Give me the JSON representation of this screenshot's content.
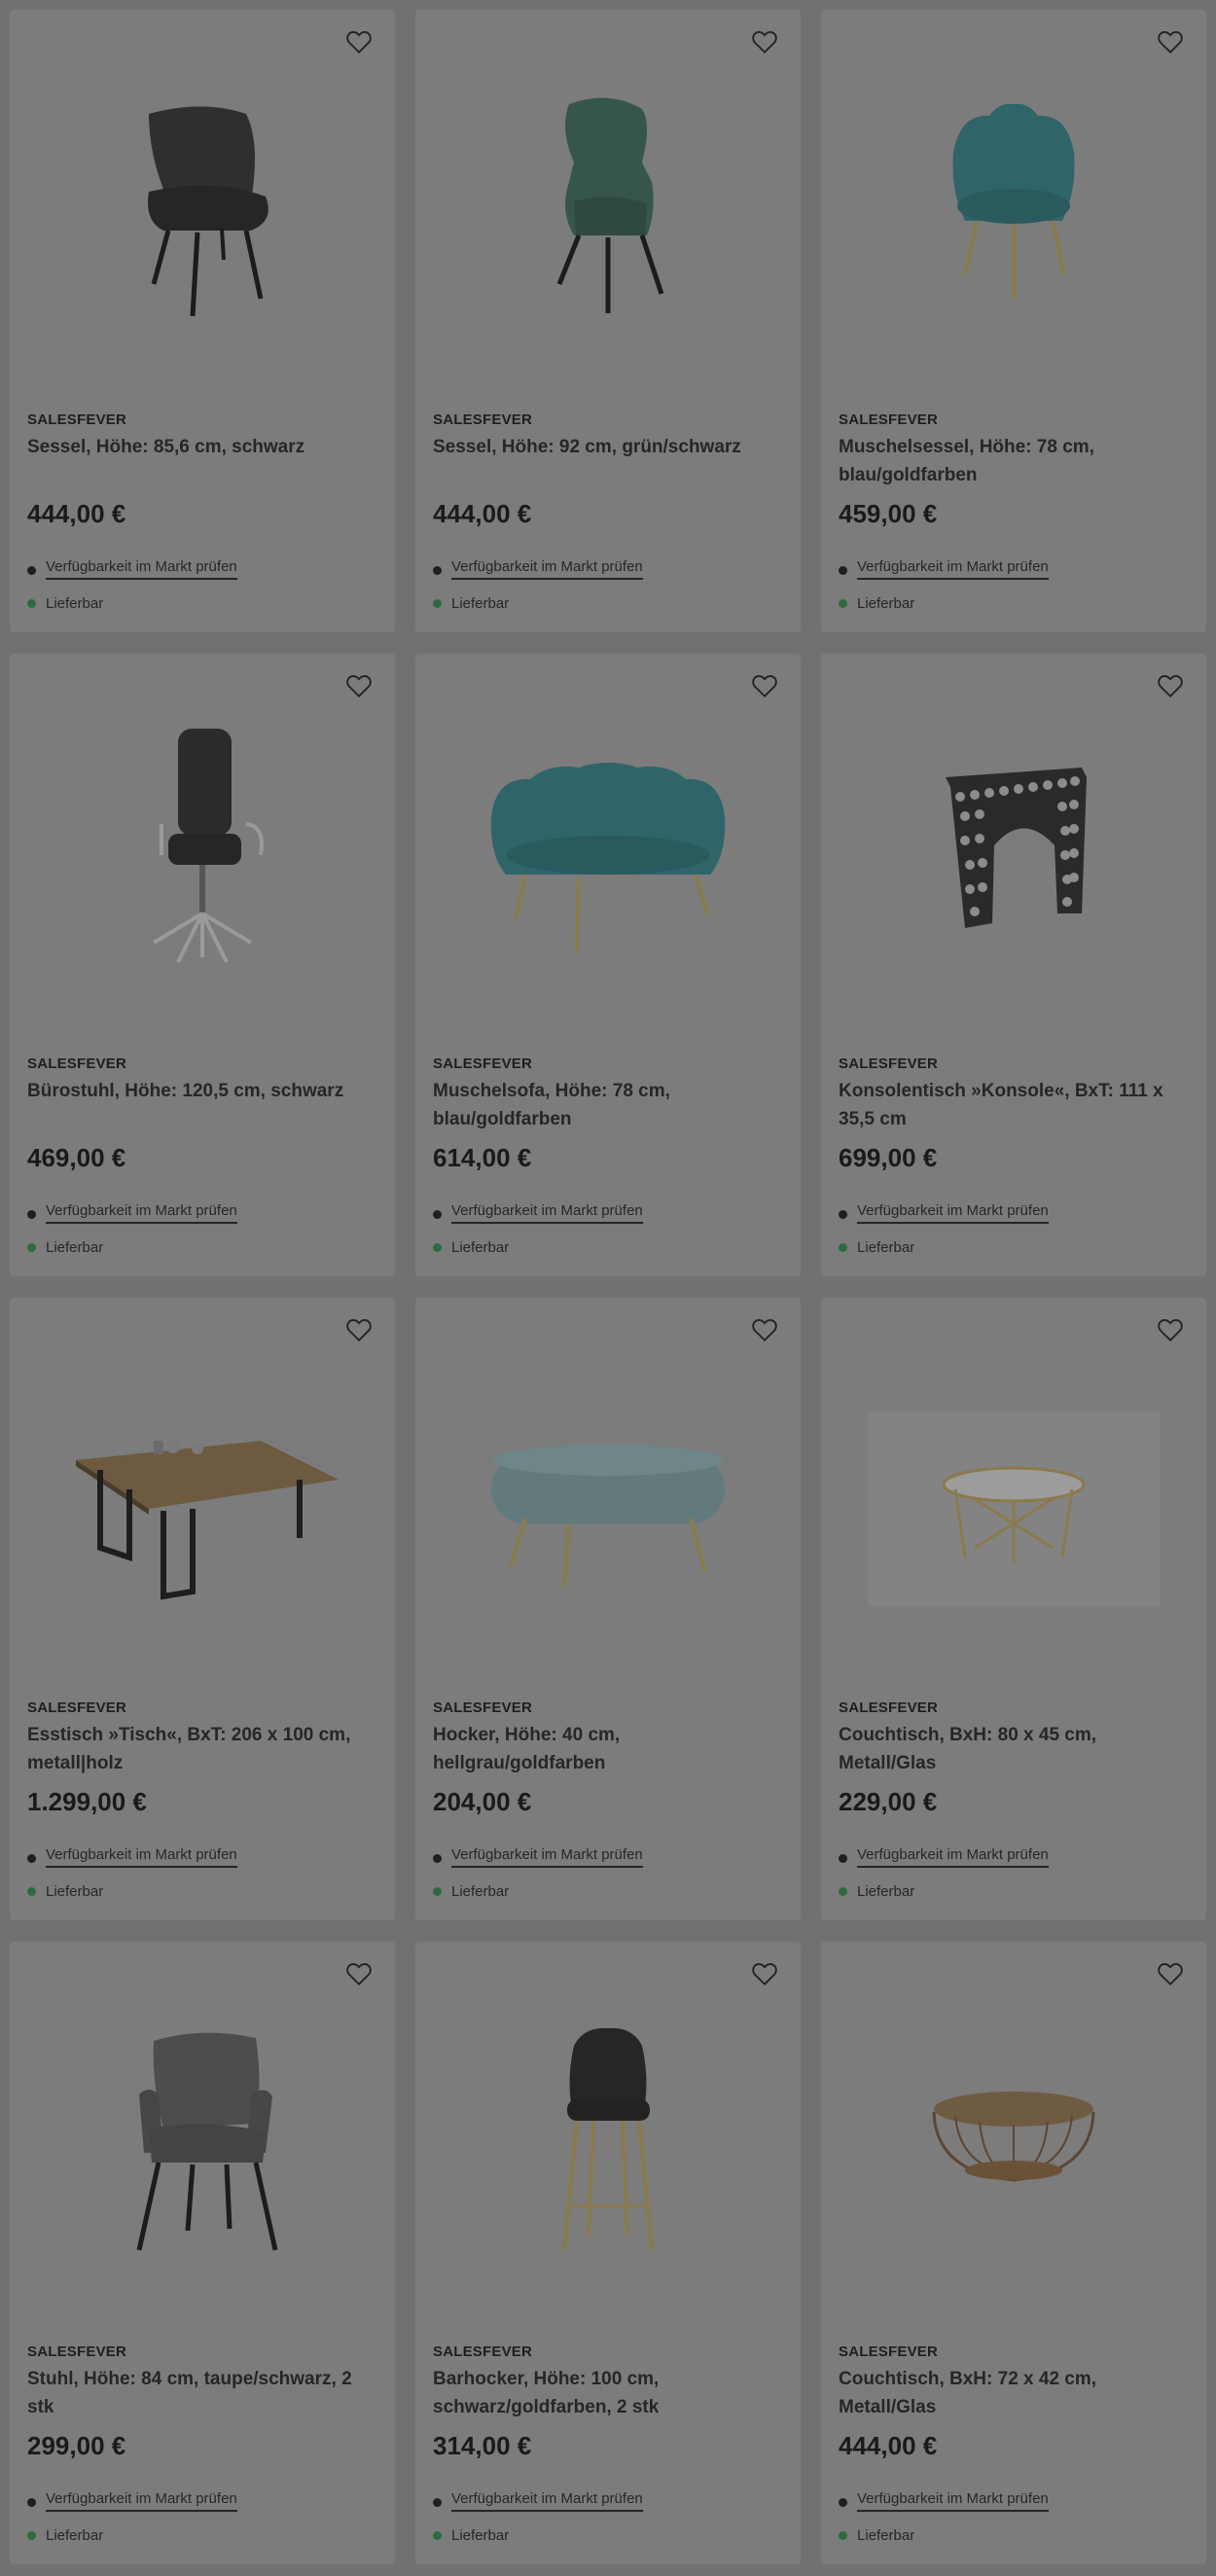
{
  "colors": {
    "available": "#2c6b3e",
    "background": "#717171",
    "card": "#7c7c7c"
  },
  "products": [
    {
      "brand": "SALESFEVER",
      "title": "Sessel, Höhe: 85,6 cm, schwarz",
      "price": "444,00 €",
      "availability_link": "Verfügbarkeit im Markt prüfen",
      "delivery": "Lieferbar",
      "image": "lounge-chair-black-image",
      "favorite_icon": "heart-icon"
    },
    {
      "brand": "SALESFEVER",
      "title": "Sessel, Höhe: 92 cm, grün/schwarz",
      "price": "444,00 €",
      "availability_link": "Verfügbarkeit im Markt prüfen",
      "delivery": "Lieferbar",
      "image": "wingback-chair-green-image",
      "favorite_icon": "heart-icon"
    },
    {
      "brand": "SALESFEVER",
      "title": "Muschelsessel, Höhe: 78 cm, blau/goldfarben",
      "price": "459,00 €",
      "availability_link": "Verfügbarkeit im Markt prüfen",
      "delivery": "Lieferbar",
      "image": "shell-armchair-teal-image",
      "favorite_icon": "heart-icon"
    },
    {
      "brand": "SALESFEVER",
      "title": "Bürostuhl, Höhe: 120,5 cm, schwarz",
      "price": "469,00 €",
      "availability_link": "Verfügbarkeit im Markt prüfen",
      "delivery": "Lieferbar",
      "image": "office-chair-black-image",
      "favorite_icon": "heart-icon"
    },
    {
      "brand": "SALESFEVER",
      "title": "Muschelsofa, Höhe: 78 cm, blau/goldfarben",
      "price": "614,00 €",
      "availability_link": "Verfügbarkeit im Markt prüfen",
      "delivery": "Lieferbar",
      "image": "shell-sofa-teal-image",
      "favorite_icon": "heart-icon"
    },
    {
      "brand": "SALESFEVER",
      "title": "Konsolentisch »Konsole«, BxT: 111 x 35,5 cm",
      "price": "699,00 €",
      "availability_link": "Verfügbarkeit im Markt prüfen",
      "delivery": "Lieferbar",
      "image": "console-table-image",
      "favorite_icon": "heart-icon"
    },
    {
      "brand": "SALESFEVER",
      "title": "Esstisch »Tisch«, BxT: 206 x 100 cm, metall|holz",
      "price": "1.299,00 €",
      "availability_link": "Verfügbarkeit im Markt prüfen",
      "delivery": "Lieferbar",
      "image": "dining-table-wood-image",
      "favorite_icon": "heart-icon"
    },
    {
      "brand": "SALESFEVER",
      "title": "Hocker, Höhe: 40 cm, hellgrau/goldfarben",
      "price": "204,00 €",
      "availability_link": "Verfügbarkeit im Markt prüfen",
      "delivery": "Lieferbar",
      "image": "bench-stool-grey-image",
      "favorite_icon": "heart-icon"
    },
    {
      "brand": "SALESFEVER",
      "title": "Couchtisch, BxH: 80 x 45 cm, Metall/Glas",
      "price": "229,00 €",
      "availability_link": "Verfügbarkeit im Markt prüfen",
      "delivery": "Lieferbar",
      "image": "coffee-table-marble-image",
      "favorite_icon": "heart-icon"
    },
    {
      "brand": "SALESFEVER",
      "title": "Stuhl, Höhe: 84 cm, taupe/schwarz, 2 stk",
      "price": "299,00 €",
      "availability_link": "Verfügbarkeit im Markt prüfen",
      "delivery": "Lieferbar",
      "image": "dining-chair-taupe-image",
      "favorite_icon": "heart-icon"
    },
    {
      "brand": "SALESFEVER",
      "title": "Barhocker, Höhe: 100 cm, schwarz/goldfarben, 2 stk",
      "price": "314,00 €",
      "availability_link": "Verfügbarkeit im Markt prüfen",
      "delivery": "Lieferbar",
      "image": "bar-stool-black-image",
      "favorite_icon": "heart-icon"
    },
    {
      "brand": "SALESFEVER",
      "title": "Couchtisch, BxH: 72 x 42 cm, Metall/Glas",
      "price": "444,00 €",
      "availability_link": "Verfügbarkeit im Markt prüfen",
      "delivery": "Lieferbar",
      "image": "coffee-table-copper-image",
      "favorite_icon": "heart-icon"
    }
  ]
}
